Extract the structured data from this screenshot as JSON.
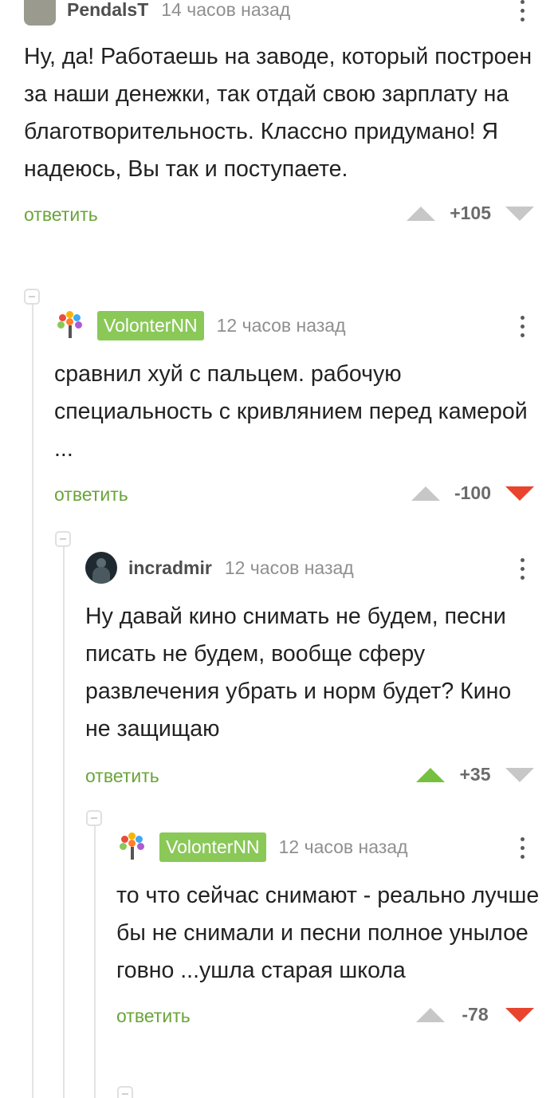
{
  "colors": {
    "accent_green": "#6aa43a",
    "badge_green": "#8ac858",
    "upvote_active": "#76c040",
    "downvote_active": "#e8442e"
  },
  "comments": [
    {
      "username": "PendalsT",
      "time": "14 часов назад",
      "text": "Ну, да! Работаешь на заводе, который построен за наши денежки, так отдай свою зарплату на благотворительность. Классно придумано! Я надеюсь, Вы так и поступаете.",
      "reply_label": "ответить",
      "score": "+105",
      "vote": "none",
      "avatar_icon": "cat-avatar-icon"
    },
    {
      "username": "VolonterNN",
      "time": "12 часов назад",
      "text": "сравнил хуй с пальцем. рабочую специальность с кривлянием перед камерой ...",
      "reply_label": "ответить",
      "score": "-100",
      "vote": "down",
      "avatar_icon": "tree-hands-avatar-icon"
    },
    {
      "username": "incradmir",
      "time": "12 часов назад",
      "text": "Ну давай кино снимать не будем, песни писать не будем, вообще сферу развлечения убрать и норм будет? Кино не защищаю",
      "reply_label": "ответить",
      "score": "+35",
      "vote": "up",
      "avatar_icon": "dark-figure-avatar-icon"
    },
    {
      "username": "VolonterNN",
      "time": "12 часов назад",
      "text": "то что сейчас снимают - реально лучше бы не снимали и песни полное унылое говно ...ушла старая школа",
      "reply_label": "ответить",
      "score": "-78",
      "vote": "down",
      "avatar_icon": "tree-hands-avatar-icon"
    }
  ]
}
